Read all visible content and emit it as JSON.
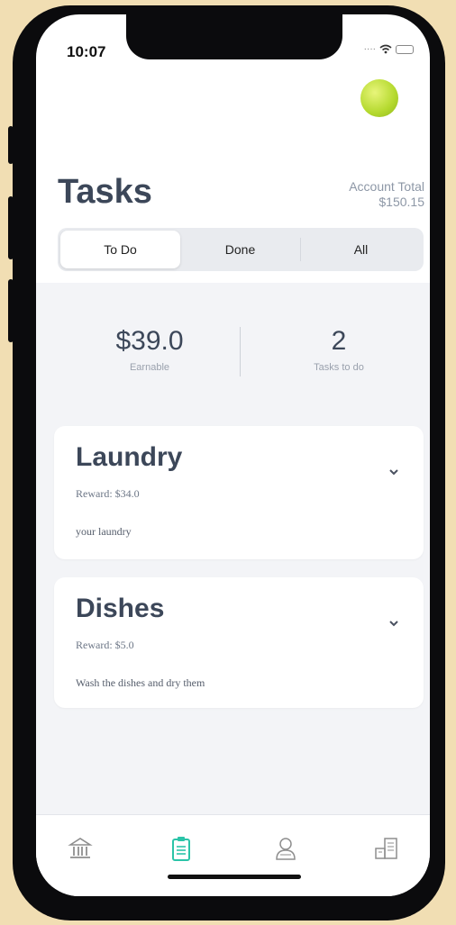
{
  "status": {
    "time": "10:07"
  },
  "header": {
    "title": "Tasks",
    "account_total_label": "Account Total",
    "account_total_value": "$150.15"
  },
  "segments": [
    {
      "label": "To Do",
      "active": true
    },
    {
      "label": "Done",
      "active": false
    },
    {
      "label": "All",
      "active": false
    }
  ],
  "summary": {
    "earnable_value": "$39.0",
    "earnable_label": "Earnable",
    "tasks_value": "2",
    "tasks_label": "Tasks to do"
  },
  "tasks": [
    {
      "title": "Laundry",
      "reward": "Reward: $34.0",
      "description": "your laundry"
    },
    {
      "title": "Dishes",
      "reward": "Reward: $5.0",
      "description": "Wash the dishes and dry them"
    }
  ],
  "tabbar": {
    "items": [
      {
        "icon": "bank-icon",
        "active": false
      },
      {
        "icon": "clipboard-icon",
        "active": true
      },
      {
        "icon": "person-icon",
        "active": false
      },
      {
        "icon": "store-icon",
        "active": false
      }
    ]
  },
  "colors": {
    "accent": "#2bc4a8",
    "text": "#3c4759",
    "avatar": "#b4d92e",
    "background": "#f1deb3"
  }
}
